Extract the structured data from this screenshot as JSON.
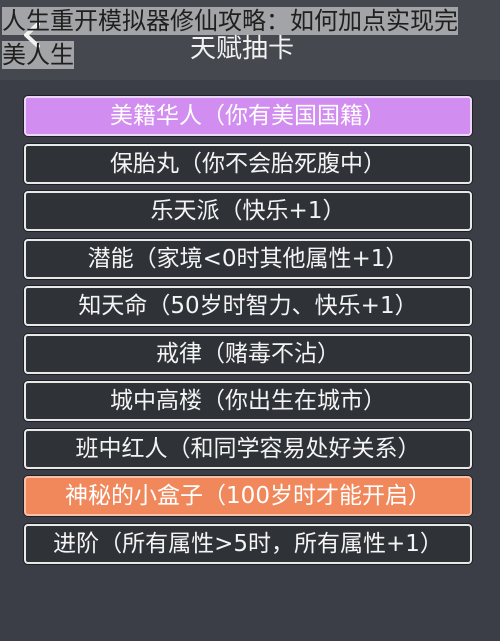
{
  "overlay": {
    "title_line1": "人生重开模拟器修仙攻略：如何加点实现完",
    "title_line2": "美人生"
  },
  "header": {
    "title": "天赋抽卡",
    "back_icon": "back-arrow-icon"
  },
  "colors": {
    "background": "#3b3e46",
    "purple_highlight": "#d18ef0",
    "orange_highlight": "#f0885c"
  },
  "talents": [
    {
      "label": "美籍华人（你有美国国籍）",
      "rarity": "purple"
    },
    {
      "label": "保胎丸（你不会胎死腹中）",
      "rarity": "normal"
    },
    {
      "label": "乐天派（快乐+1）",
      "rarity": "normal"
    },
    {
      "label": "潜能（家境<0时其他属性+1）",
      "rarity": "normal"
    },
    {
      "label": "知天命（50岁时智力、快乐+1）",
      "rarity": "normal"
    },
    {
      "label": "戒律（赌毒不沾）",
      "rarity": "normal"
    },
    {
      "label": "城中高楼（你出生在城市）",
      "rarity": "normal"
    },
    {
      "label": "班中红人（和同学容易处好关系）",
      "rarity": "normal"
    },
    {
      "label": "神秘的小盒子（100岁时才能开启）",
      "rarity": "orange"
    },
    {
      "label": "进阶（所有属性>5时，所有属性+1）",
      "rarity": "normal"
    }
  ]
}
